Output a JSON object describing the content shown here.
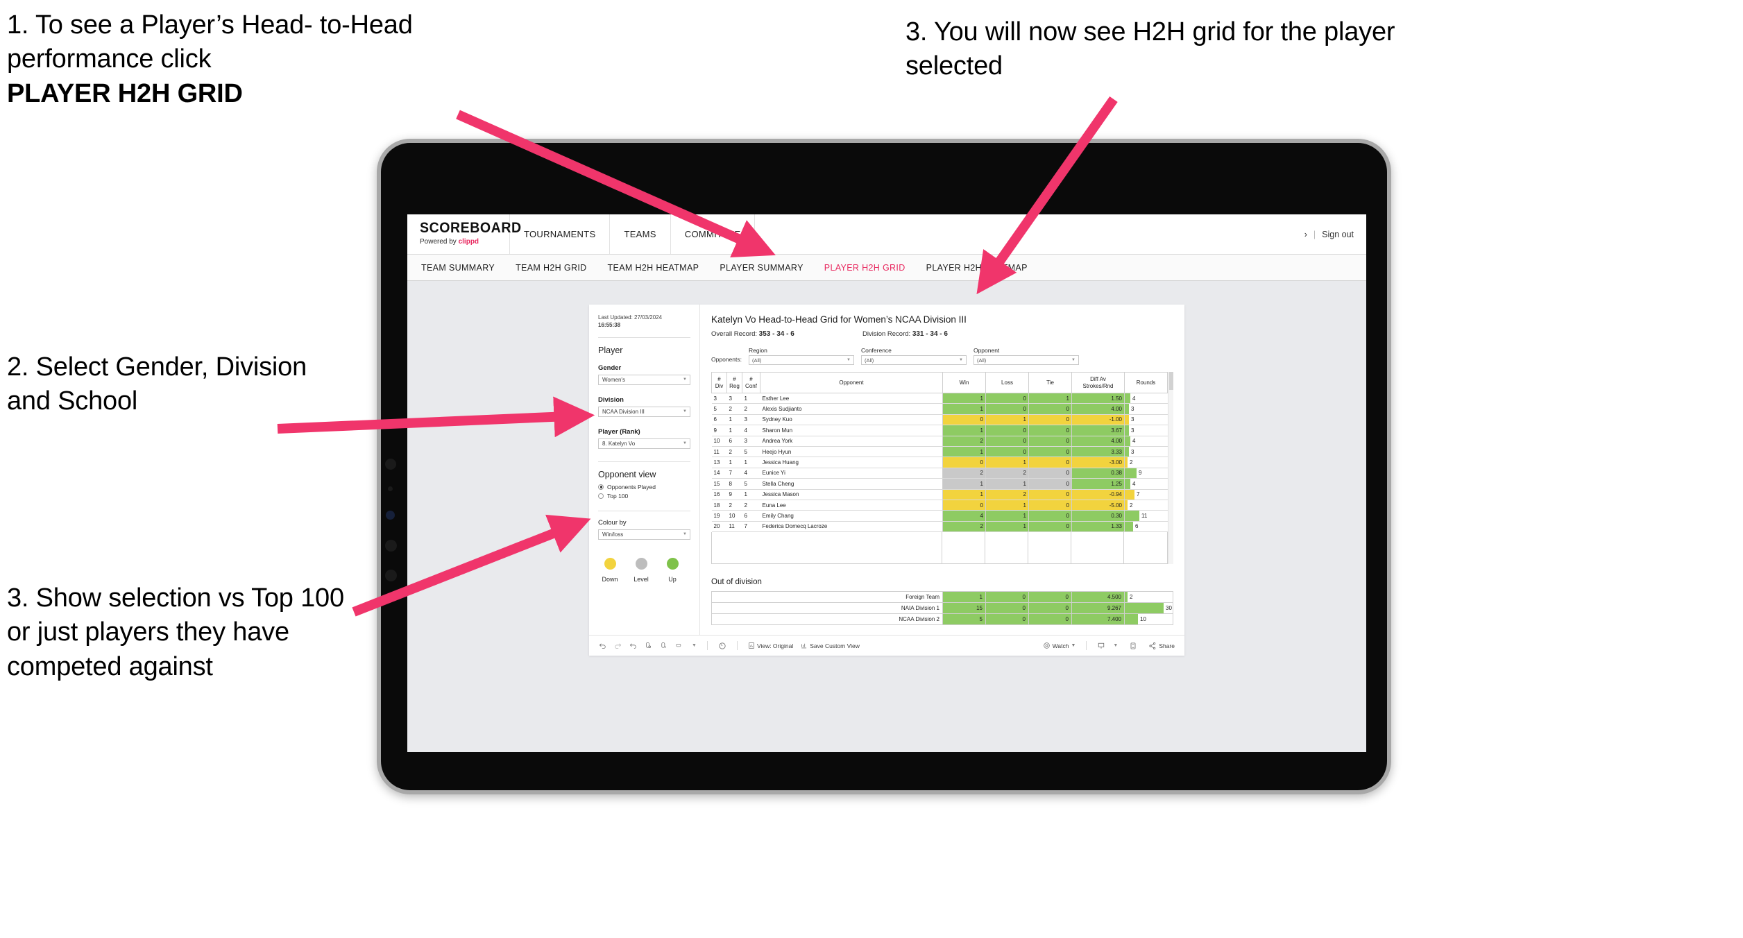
{
  "annotations": {
    "a1_line1": "1. To see a Player’s Head-",
    "a1_line2": "to-Head performance click",
    "a1_bold": "PLAYER H2H GRID",
    "a2": "2. Select Gender, Division and School",
    "a3": "3. Show selection vs Top 100 or just players they have competed against",
    "a4": "3. You will now see H2H grid for the player selected"
  },
  "app": {
    "logo_word": "SCOREBOARD",
    "logo_sub_prefix": "Powered by ",
    "logo_sub_brand": "clippd",
    "top_nav": [
      "TOURNAMENTS",
      "TEAMS",
      "COMMITTEE"
    ],
    "sign_out": "Sign out",
    "sign_out_sep": "|",
    "sign_out_caret": "›",
    "sub_nav": [
      {
        "label": "TEAM SUMMARY",
        "active": false
      },
      {
        "label": "TEAM H2H GRID",
        "active": false
      },
      {
        "label": "TEAM H2H HEATMAP",
        "active": false
      },
      {
        "label": "PLAYER SUMMARY",
        "active": false
      },
      {
        "label": "PLAYER H2H GRID",
        "active": true
      },
      {
        "label": "PLAYER H2H HEATMAP",
        "active": false
      }
    ],
    "accent_color": "#e8285f"
  },
  "sidepanel": {
    "last_updated_label": "Last Updated: 27/03/2024",
    "last_updated_time": "16:55:38",
    "player_group_title": "Player",
    "gender_label": "Gender",
    "gender_value": "Women's",
    "division_label": "Division",
    "division_value": "NCAA Division III",
    "player_rank_label": "Player (Rank)",
    "player_rank_value": "8. Katelyn Vo",
    "opponent_view_title": "Opponent view",
    "opponent_view_options": [
      {
        "label": "Opponents Played",
        "selected": true
      },
      {
        "label": "Top 100",
        "selected": false
      }
    ],
    "colour_by_label": "Colour by",
    "colour_by_value": "Win/loss",
    "legend": [
      {
        "label": "Down",
        "color": "#f2d33e"
      },
      {
        "label": "Level",
        "color": "#bdbdbd"
      },
      {
        "label": "Up",
        "color": "#7fc24a"
      }
    ]
  },
  "viz": {
    "title": "Katelyn Vo Head-to-Head Grid for Women’s NCAA Division III",
    "overall_record_label": "Overall Record:",
    "overall_record_value": "353 - 34 - 6",
    "division_record_label": "Division Record:",
    "division_record_value": "331 - 34 - 6",
    "opponents_label": "Opponents:",
    "filters": [
      {
        "label": "Region",
        "value": "(All)"
      },
      {
        "label": "Conference",
        "value": "(All)"
      },
      {
        "label": "Opponent",
        "value": "(All)"
      }
    ],
    "columns": [
      "# Div",
      "# Reg",
      "# Conf",
      "Opponent",
      "Win",
      "Loss",
      "Tie",
      "Diff Av Strokes/Rnd",
      "Rounds"
    ],
    "column_headers": [
      {
        "l1": "#",
        "l2": "Div"
      },
      {
        "l1": "#",
        "l2": "Reg"
      },
      {
        "l1": "#",
        "l2": "Conf"
      },
      {
        "l1": "Opponent",
        "l2": ""
      },
      {
        "l1": "Win",
        "l2": ""
      },
      {
        "l1": "Loss",
        "l2": ""
      },
      {
        "l1": "Tie",
        "l2": ""
      },
      {
        "l1": "Diff Av",
        "l2": "Strokes/Rnd"
      },
      {
        "l1": "Rounds",
        "l2": ""
      }
    ],
    "rows": [
      {
        "div": "3",
        "reg": "3",
        "conf": "1",
        "opponent": "Esther Lee",
        "win": "1",
        "loss": "0",
        "tie": "1",
        "diff": "1.50",
        "rounds": 4,
        "color": "#8ecb63"
      },
      {
        "div": "5",
        "reg": "2",
        "conf": "2",
        "opponent": "Alexis Sudjianto",
        "win": "1",
        "loss": "0",
        "tie": "0",
        "diff": "4.00",
        "rounds": 3,
        "color": "#8ecb63"
      },
      {
        "div": "6",
        "reg": "1",
        "conf": "3",
        "opponent": "Sydney Kuo",
        "win": "0",
        "loss": "1",
        "tie": "0",
        "diff": "-1.00",
        "rounds": 3,
        "color": "#f2d33e"
      },
      {
        "div": "9",
        "reg": "1",
        "conf": "4",
        "opponent": "Sharon Mun",
        "win": "1",
        "loss": "0",
        "tie": "0",
        "diff": "3.67",
        "rounds": 3,
        "color": "#8ecb63"
      },
      {
        "div": "10",
        "reg": "6",
        "conf": "3",
        "opponent": "Andrea York",
        "win": "2",
        "loss": "0",
        "tie": "0",
        "diff": "4.00",
        "rounds": 4,
        "color": "#8ecb63"
      },
      {
        "div": "11",
        "reg": "2",
        "conf": "5",
        "opponent": "Heejo Hyun",
        "win": "1",
        "loss": "0",
        "tie": "0",
        "diff": "3.33",
        "rounds": 3,
        "color": "#8ecb63"
      },
      {
        "div": "13",
        "reg": "1",
        "conf": "1",
        "opponent": "Jessica Huang",
        "win": "0",
        "loss": "1",
        "tie": "0",
        "diff": "-3.00",
        "rounds": 2,
        "color": "#f2d33e"
      },
      {
        "div": "14",
        "reg": "7",
        "conf": "4",
        "opponent": "Eunice Yi",
        "win": "2",
        "loss": "2",
        "tie": "0",
        "diff": "0.38",
        "rounds": 9,
        "color": "#c9c9c9",
        "diff_color": "#8ecb63"
      },
      {
        "div": "15",
        "reg": "8",
        "conf": "5",
        "opponent": "Stella Cheng",
        "win": "1",
        "loss": "1",
        "tie": "0",
        "diff": "1.25",
        "rounds": 4,
        "color": "#c9c9c9",
        "diff_color": "#8ecb63"
      },
      {
        "div": "16",
        "reg": "9",
        "conf": "1",
        "opponent": "Jessica Mason",
        "win": "1",
        "loss": "2",
        "tie": "0",
        "diff": "-0.94",
        "rounds": 7,
        "color": "#f2d33e"
      },
      {
        "div": "18",
        "reg": "2",
        "conf": "2",
        "opponent": "Euna Lee",
        "win": "0",
        "loss": "1",
        "tie": "0",
        "diff": "-5.00",
        "rounds": 2,
        "color": "#f2d33e"
      },
      {
        "div": "19",
        "reg": "10",
        "conf": "6",
        "opponent": "Emily Chang",
        "win": "4",
        "loss": "1",
        "tie": "0",
        "diff": "0.30",
        "rounds": 11,
        "color": "#8ecb63"
      },
      {
        "div": "20",
        "reg": "11",
        "conf": "7",
        "opponent": "Federica Domecq Lacroze",
        "win": "2",
        "loss": "1",
        "tie": "0",
        "diff": "1.33",
        "rounds": 6,
        "color": "#8ecb63"
      }
    ],
    "out_of_division_title": "Out of division",
    "out_of_division_rows": [
      {
        "name": "Foreign Team",
        "win": "1",
        "loss": "0",
        "tie": "0",
        "diff": "4.500",
        "rounds": 2,
        "color": "#8ecb63"
      },
      {
        "name": "NAIA Division 1",
        "win": "15",
        "loss": "0",
        "tie": "0",
        "diff": "9.267",
        "rounds": 30,
        "color": "#8ecb63"
      },
      {
        "name": "NCAA Division 2",
        "win": "5",
        "loss": "0",
        "tie": "0",
        "diff": "7.400",
        "rounds": 10,
        "color": "#8ecb63"
      }
    ],
    "rounds_max": 30
  },
  "toolbar": {
    "view_label": "View: Original",
    "save_label": "Save Custom View",
    "watch_label": "Watch",
    "share_label": "Share",
    "caret": "▾"
  },
  "chart_data": {
    "type": "table",
    "title": "Katelyn Vo Head-to-Head Grid for Women’s NCAA Division III",
    "columns": [
      "# Div",
      "# Reg",
      "# Conf",
      "Opponent",
      "Win",
      "Loss",
      "Tie",
      "Diff Av Strokes/Rnd",
      "Rounds"
    ],
    "rows": [
      [
        "3",
        "3",
        "1",
        "Esther Lee",
        1,
        0,
        1,
        1.5,
        4
      ],
      [
        "5",
        "2",
        "2",
        "Alexis Sudjianto",
        1,
        0,
        0,
        4.0,
        3
      ],
      [
        "6",
        "1",
        "3",
        "Sydney Kuo",
        0,
        1,
        0,
        -1.0,
        3
      ],
      [
        "9",
        "1",
        "4",
        "Sharon Mun",
        1,
        0,
        0,
        3.67,
        3
      ],
      [
        "10",
        "6",
        "3",
        "Andrea York",
        2,
        0,
        0,
        4.0,
        4
      ],
      [
        "11",
        "2",
        "5",
        "Heejo Hyun",
        1,
        0,
        0,
        3.33,
        3
      ],
      [
        "13",
        "1",
        "1",
        "Jessica Huang",
        0,
        1,
        0,
        -3.0,
        2
      ],
      [
        "14",
        "7",
        "4",
        "Eunice Yi",
        2,
        2,
        0,
        0.38,
        9
      ],
      [
        "15",
        "8",
        "5",
        "Stella Cheng",
        1,
        1,
        0,
        1.25,
        4
      ],
      [
        "16",
        "9",
        "1",
        "Jessica Mason",
        1,
        2,
        0,
        -0.94,
        7
      ],
      [
        "18",
        "2",
        "2",
        "Euna Lee",
        0,
        1,
        0,
        -5.0,
        2
      ],
      [
        "19",
        "10",
        "6",
        "Emily Chang",
        4,
        1,
        0,
        0.3,
        11
      ],
      [
        "20",
        "11",
        "7",
        "Federica Domecq Lacroze",
        2,
        1,
        0,
        1.33,
        6
      ]
    ],
    "out_of_division": [
      [
        "Foreign Team",
        1,
        0,
        0,
        4.5,
        2
      ],
      [
        "NAIA Division 1",
        15,
        0,
        0,
        9.267,
        30
      ],
      [
        "NCAA Division 2",
        5,
        0,
        0,
        7.4,
        10
      ]
    ],
    "colour_encoding": {
      "up": "#7fc24a",
      "level": "#bdbdbd",
      "down": "#f2d33e"
    },
    "legend_position": "sidebar"
  }
}
